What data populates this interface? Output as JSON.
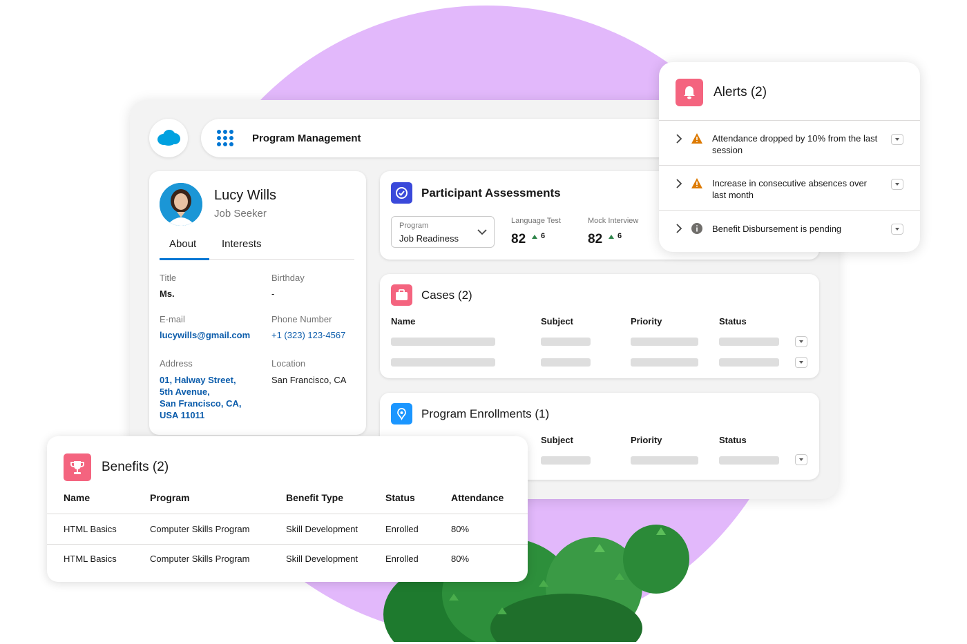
{
  "app": {
    "title": "Program Management"
  },
  "profile": {
    "name": "Lucy Wills",
    "role": "Job Seeker",
    "tabs": [
      "About",
      "Interests"
    ],
    "active_tab": "About",
    "fields": {
      "title_label": "Title",
      "title_value": "Ms.",
      "birthday_label": "Birthday",
      "birthday_value": "-",
      "email_label": "E-mail",
      "email_value": "lucywills@gmail.com",
      "phone_label": "Phone Number",
      "phone_value": "+1 (323) 123-4567",
      "address_label": "Address",
      "address_lines": [
        "01, Halway Street,",
        "5th Avenue,",
        "San Francisco, CA,",
        "USA 11011"
      ],
      "location_label": "Location",
      "location_value": "San Francisco, CA"
    }
  },
  "assessments": {
    "title": "Participant Assessments",
    "program_label": "Program",
    "program_value": "Job Readiness",
    "metrics": [
      {
        "label": "Language Test",
        "value": "82",
        "delta": "6"
      },
      {
        "label": "Mock Interview",
        "value": "82",
        "delta": "6"
      }
    ]
  },
  "cases": {
    "title": "Cases (2)",
    "columns": [
      "Name",
      "Subject",
      "Priority",
      "Status"
    ]
  },
  "enrollments": {
    "title": "Program Enrollments (1)",
    "columns": [
      "Subject",
      "Priority",
      "Status"
    ]
  },
  "alerts": {
    "title": "Alerts (2)",
    "items": [
      {
        "icon": "warning-icon",
        "text": "Attendance dropped by 10% from the last session"
      },
      {
        "icon": "warning-icon",
        "text": "Increase in consecutive absences over last month"
      },
      {
        "icon": "info-icon",
        "text": "Benefit Disbursement is pending"
      }
    ]
  },
  "benefits": {
    "title": "Benefits (2)",
    "columns": [
      "Name",
      "Program",
      "Benefit Type",
      "Status",
      "Attendance"
    ],
    "rows": [
      [
        "HTML Basics",
        "Computer Skills Program",
        "Skill Development",
        "Enrolled",
        "80%"
      ],
      [
        "HTML Basics",
        "Computer Skills Program",
        "Skill Development",
        "Enrolled",
        "80%"
      ]
    ]
  },
  "colors": {
    "accent_blue": "#0176d3",
    "link_blue": "#0b5cab",
    "assessment_icon": "#3a49da",
    "cases_icon": "#f4647f",
    "enroll_icon": "#1b96ff",
    "alert_icon": "#f4647f",
    "benefit_icon": "#f4647f",
    "warning": "#dd7a01",
    "trend_up": "#2e844a",
    "background_circle": "#e2b8fb"
  }
}
